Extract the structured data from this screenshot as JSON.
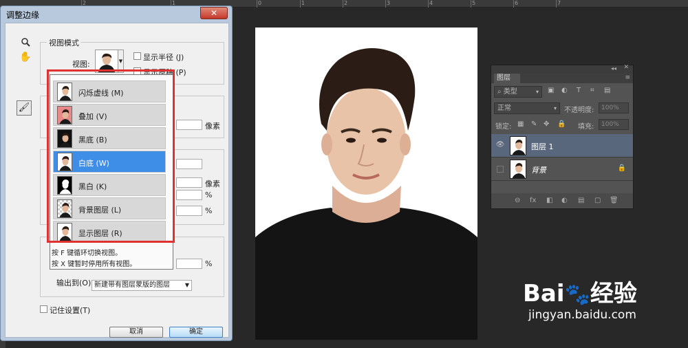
{
  "dialog": {
    "title": "调整边缘",
    "close": "✕",
    "view_mode_group": "视图模式",
    "view_label": "视图:",
    "show_radius": "显示半径 (J)",
    "show_original": "显示原稿 (P)",
    "unit_px_1": "像素",
    "unit_px_2": "像素",
    "unit_pct_1": "%",
    "unit_pct_2": "%",
    "unit_pct_3": "%",
    "output_label": "输出到(O):",
    "output_value": "新建带有图层蒙版的图层",
    "remember": "记住设置(T)",
    "cancel": "取消",
    "ok": "确定"
  },
  "view_menu": {
    "items": [
      {
        "label": "闪烁虚线 (M)",
        "icon": "marching-ants"
      },
      {
        "label": "叠加 (V)",
        "icon": "overlay"
      },
      {
        "label": "黑底 (B)",
        "icon": "on-black"
      },
      {
        "label": "白底 (W)",
        "icon": "on-white",
        "selected": true
      },
      {
        "label": "黑白 (K)",
        "icon": "black-white"
      },
      {
        "label": "背景图层 (L)",
        "icon": "on-layers"
      },
      {
        "label": "显示图层 (R)",
        "icon": "reveal-layer"
      }
    ],
    "hint1": "按 F 键循环切换视图。",
    "hint2": "按 X 键暂时停用所有视图。"
  },
  "layers": {
    "tab": "图层",
    "filter": "类型",
    "blend": "正常",
    "opacity_label": "不透明度:",
    "opacity": "100%",
    "lock_label": "锁定:",
    "fill_label": "填充:",
    "fill": "100%",
    "items": [
      {
        "name": "图层 1",
        "active": true
      },
      {
        "name": "背景",
        "active": false
      }
    ],
    "footer": [
      "⊖",
      "fx",
      "◧",
      "◐",
      "▤",
      "▢",
      "🗑"
    ]
  },
  "watermark": {
    "brand": "Bai",
    "brand2": "经验",
    "url": "jingyan.baidu.com"
  },
  "ruler": {
    "top": [
      "2",
      "1",
      "0",
      "1",
      "2",
      "3",
      "4",
      "5",
      "6",
      "7"
    ],
    "side": [
      "1",
      "2",
      "3"
    ]
  }
}
